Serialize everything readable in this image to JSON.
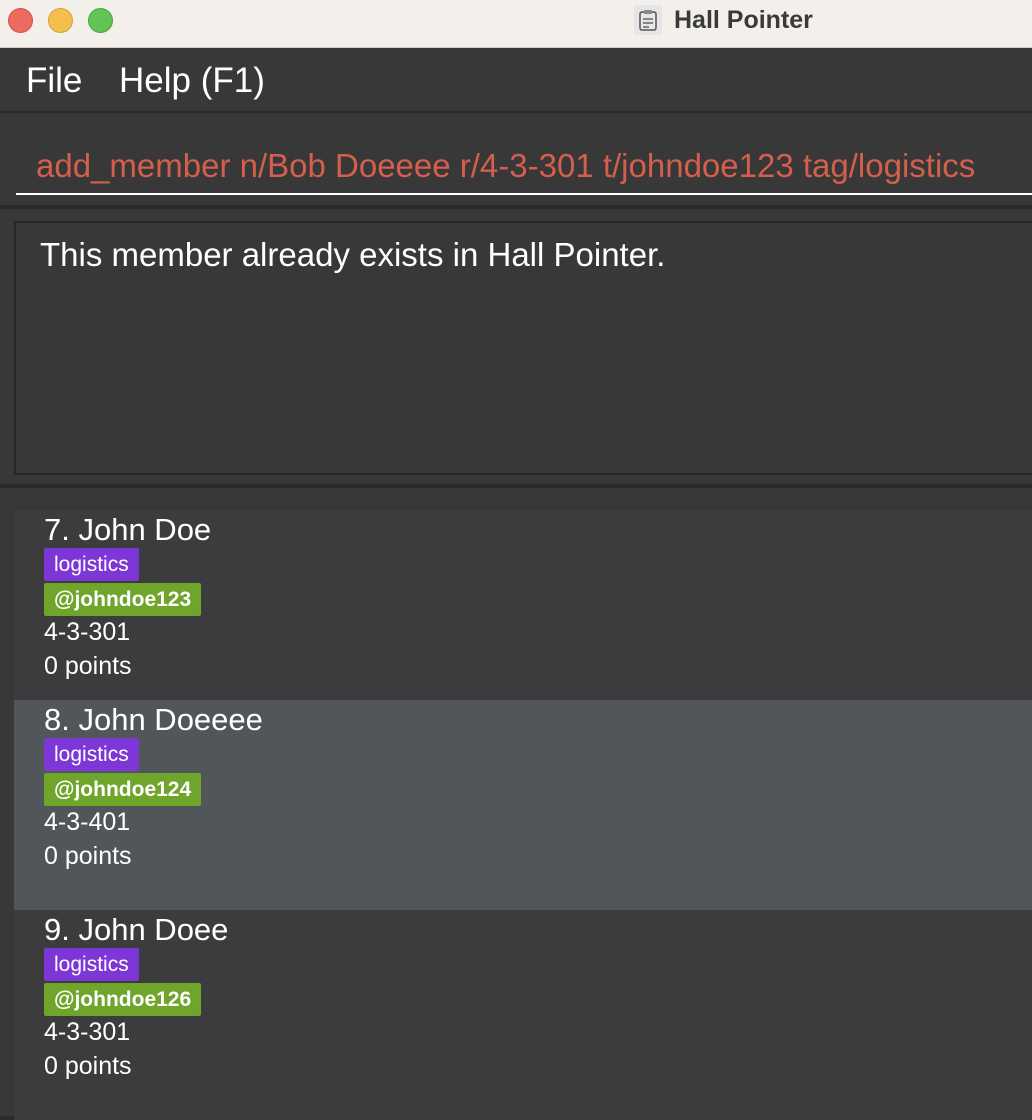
{
  "window": {
    "title": "Hall Pointer"
  },
  "menu": {
    "file_label": "File",
    "help_label": "Help (F1)"
  },
  "command": {
    "value": "add_member n/Bob Doeeee r/4-3-301 t/johndoe123 tag/logistics",
    "text_color": "#d35f4c"
  },
  "result": {
    "message": "This member already exists in Hall Pointer."
  },
  "colors": {
    "tag_role": "#7c37d6",
    "tag_telegram": "#70a52b",
    "selected_card": "#515658"
  },
  "members": [
    {
      "name": "7. John Doe",
      "tag": "logistics",
      "telegram": "@johndoe123",
      "room": "4-3-301",
      "points": "0 points"
    },
    {
      "name": "8. John Doeeee",
      "tag": "logistics",
      "telegram": "@johndoe124",
      "room": "4-3-401",
      "points": "0 points"
    },
    {
      "name": "9. John Doee",
      "tag": "logistics",
      "telegram": "@johndoe126",
      "room": "4-3-301",
      "points": "0 points"
    }
  ]
}
